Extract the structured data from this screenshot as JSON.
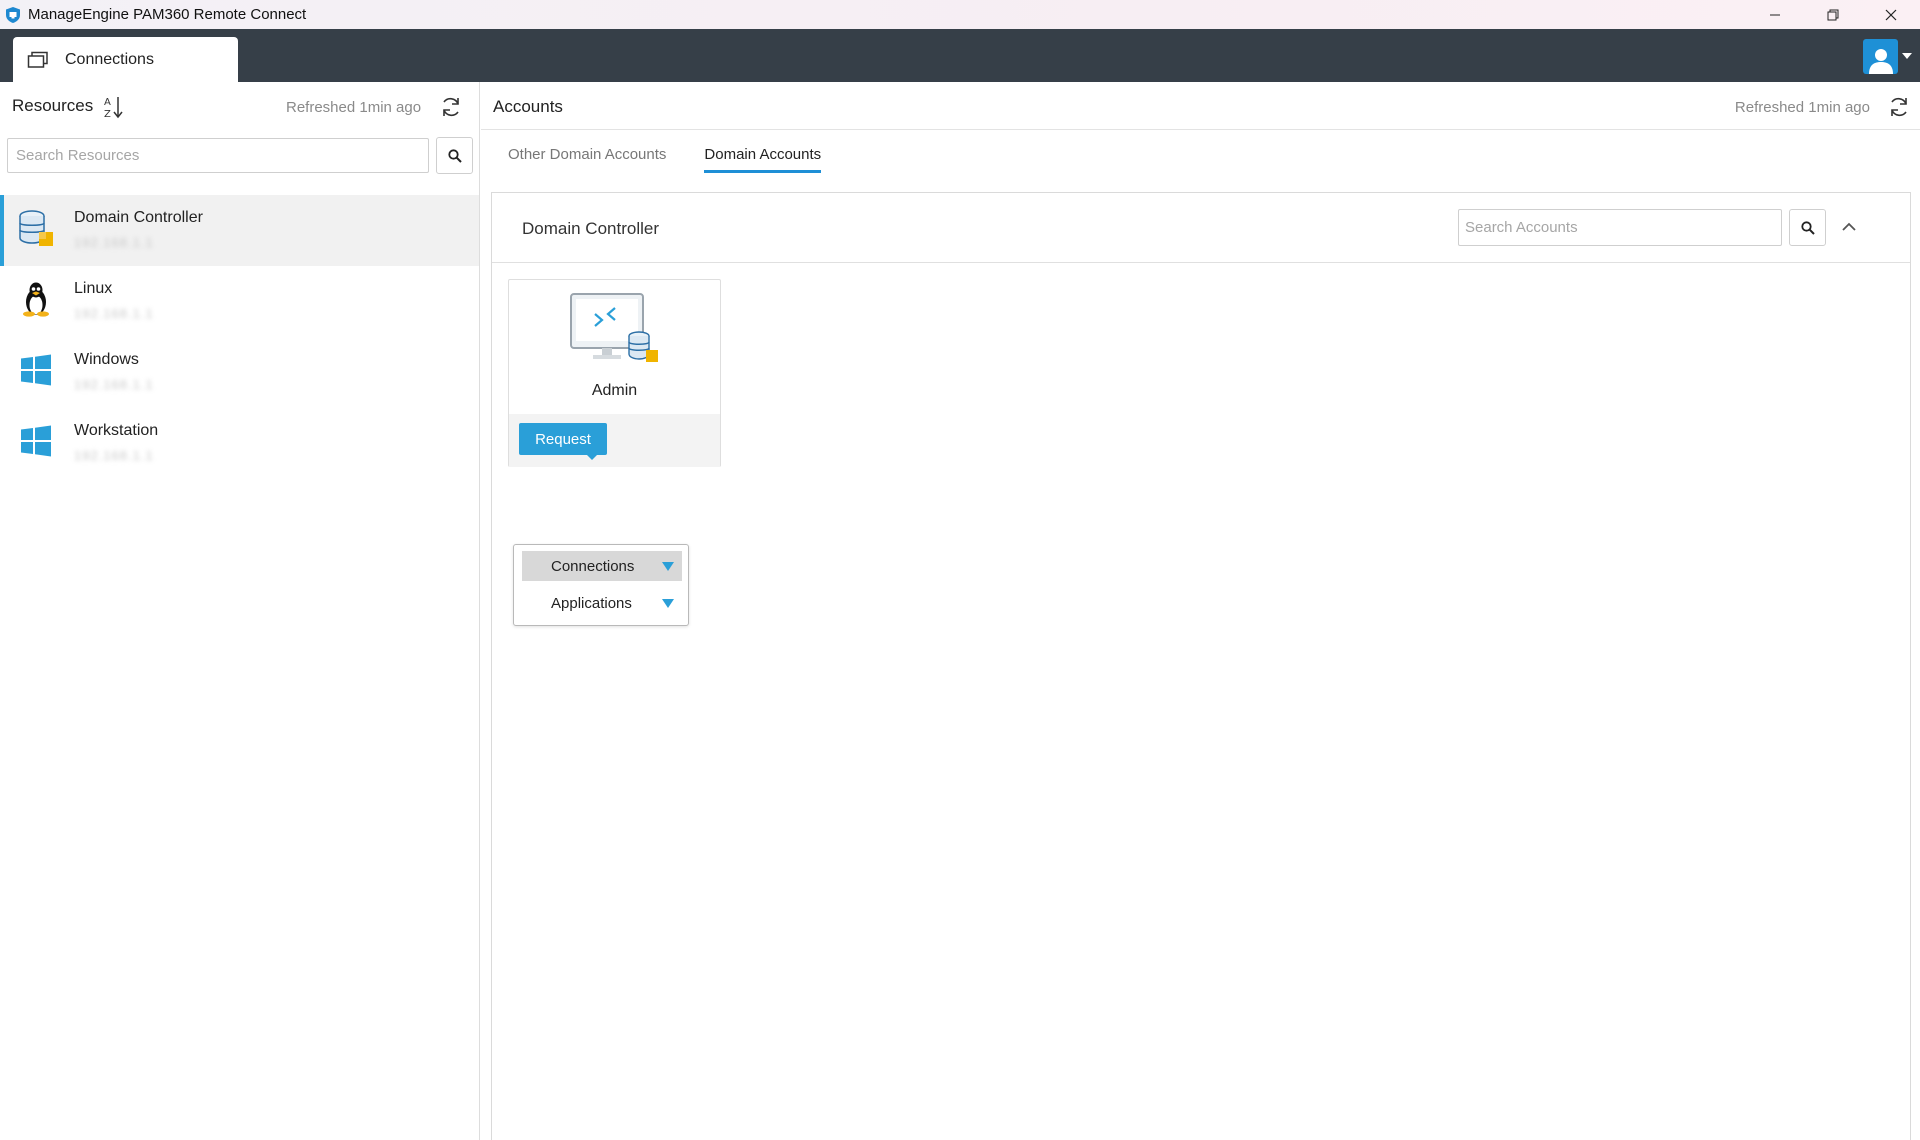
{
  "window": {
    "title": "ManageEngine PAM360 Remote Connect"
  },
  "top_tabs": [
    {
      "label": "Connections",
      "icon": "windows-icon"
    }
  ],
  "resources": {
    "title": "Resources",
    "refreshed": "Refreshed 1min ago",
    "search_placeholder": "Search Resources",
    "items": [
      {
        "name": "Domain Controller",
        "ip": "192.168.1.1",
        "icon": "domain-controller-icon",
        "active": true
      },
      {
        "name": "Linux",
        "ip": "192.168.1.1",
        "icon": "linux-icon",
        "active": false
      },
      {
        "name": "Windows",
        "ip": "192.168.1.1",
        "icon": "windows-logo-icon",
        "active": false
      },
      {
        "name": "Workstation",
        "ip": "192.168.1.1",
        "icon": "windows-logo-icon",
        "active": false
      }
    ]
  },
  "accounts": {
    "title": "Accounts",
    "refreshed": "Refreshed 1min ago",
    "tabs": [
      {
        "label": "Other Domain Accounts",
        "active": false
      },
      {
        "label": "Domain Accounts",
        "active": true
      }
    ],
    "group": {
      "title": "Domain Controller",
      "search_placeholder": "Search Accounts",
      "cards": [
        {
          "name": "Admin",
          "request_label": "Request"
        }
      ]
    },
    "dropdown": {
      "items": [
        {
          "label": "Connections",
          "highlighted": true
        },
        {
          "label": "Applications",
          "highlighted": false
        }
      ]
    }
  },
  "colors": {
    "accent": "#2a9fd8",
    "tabbar": "#363f48"
  }
}
